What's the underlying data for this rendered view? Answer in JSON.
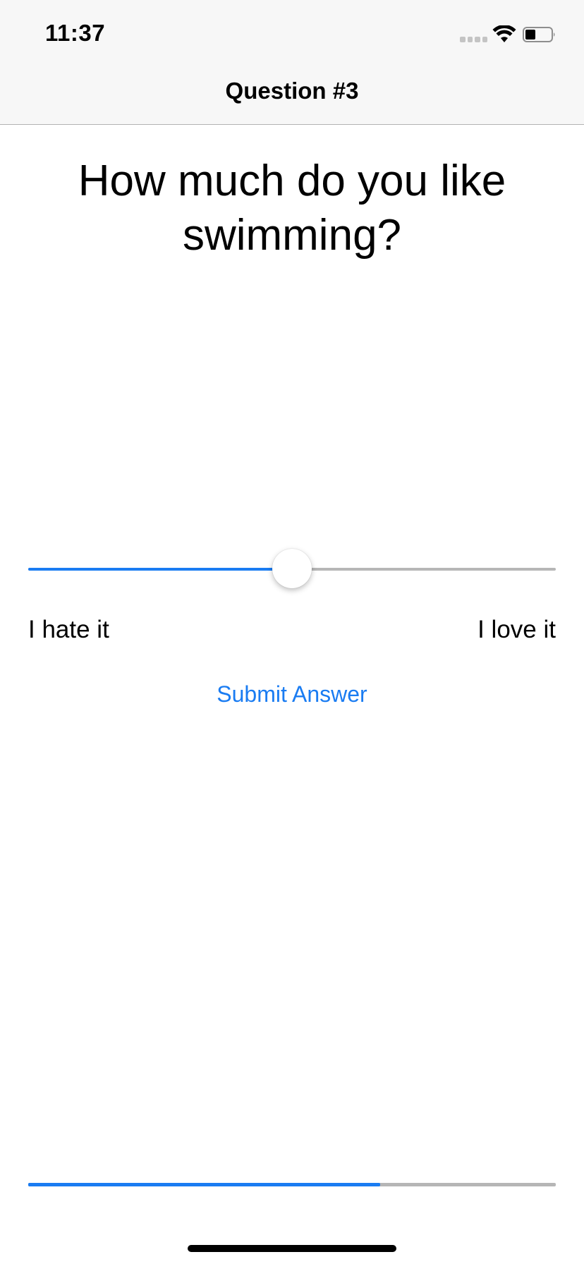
{
  "status_bar": {
    "time": "11:37",
    "icons": [
      "cellular-signal-icon",
      "wifi-icon",
      "battery-icon"
    ]
  },
  "nav": {
    "title": "Question #3"
  },
  "question": {
    "text": "How much do you like swimming?"
  },
  "slider": {
    "value": 0.5,
    "min_label": "I hate it",
    "max_label": "I love it"
  },
  "submit_label": "Submit Answer",
  "progress": {
    "fraction": 0.667
  },
  "colors": {
    "accent": "#1a7cf2",
    "track": "#b6b6b6",
    "nav_background": "#f7f7f7"
  }
}
